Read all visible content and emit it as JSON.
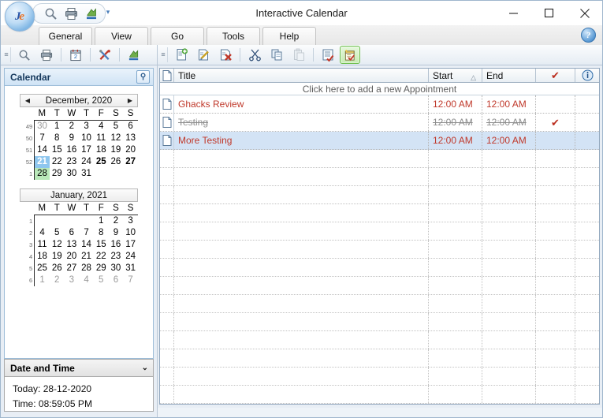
{
  "window": {
    "title": "Interactive Calendar",
    "logo_text_1": "J",
    "logo_text_2": "e",
    "minimize_label": "Minimize",
    "maximize_label": "Maximize",
    "close_label": "Close"
  },
  "quick_access": {
    "items": [
      {
        "name": "search-icon",
        "label": "Search"
      },
      {
        "name": "print-icon",
        "label": "Print"
      },
      {
        "name": "export-icon",
        "label": "Export"
      }
    ],
    "customize_label": "Customize Quick Access Toolbar"
  },
  "tabs": [
    {
      "label": "General"
    },
    {
      "label": "View"
    },
    {
      "label": "Go"
    },
    {
      "label": "Tools"
    },
    {
      "label": "Help"
    }
  ],
  "help_button_label": "?",
  "left_toolbar": {
    "items": [
      {
        "name": "search-icon",
        "label": "Search"
      },
      {
        "name": "print-icon",
        "label": "Print"
      },
      {
        "name": "calendar-icon",
        "label": "Calendar"
      },
      {
        "name": "tools-icon",
        "label": "Tools"
      },
      {
        "name": "export-icon",
        "label": "Export"
      }
    ]
  },
  "right_toolbar": {
    "items": [
      {
        "name": "new-appointment-icon",
        "label": "New Appointment"
      },
      {
        "name": "edit-appointment-icon",
        "label": "Edit Appointment"
      },
      {
        "name": "delete-appointment-icon",
        "label": "Delete Appointment"
      },
      {
        "name": "cut-icon",
        "label": "Cut"
      },
      {
        "name": "copy-icon",
        "label": "Copy"
      },
      {
        "name": "paste-icon",
        "label": "Paste"
      },
      {
        "name": "tasks-icon",
        "label": "Tasks"
      },
      {
        "name": "appointments-icon",
        "label": "Appointments"
      }
    ]
  },
  "calendar_panel": {
    "title": "Calendar",
    "pin_label": "Pin",
    "months": [
      {
        "title": "December, 2020",
        "prev_label": "Previous month",
        "next_label": "Next month",
        "show_nav": true,
        "dow": [
          "M",
          "T",
          "W",
          "T",
          "F",
          "S",
          "S"
        ],
        "weeks": [
          {
            "num": "49",
            "days": [
              {
                "d": "30",
                "cls": "oth"
              },
              {
                "d": "1"
              },
              {
                "d": "2"
              },
              {
                "d": "3"
              },
              {
                "d": "4"
              },
              {
                "d": "5"
              },
              {
                "d": "6"
              }
            ]
          },
          {
            "num": "50",
            "days": [
              {
                "d": "7"
              },
              {
                "d": "8"
              },
              {
                "d": "9"
              },
              {
                "d": "10"
              },
              {
                "d": "11"
              },
              {
                "d": "12"
              },
              {
                "d": "13"
              }
            ]
          },
          {
            "num": "51",
            "days": [
              {
                "d": "14"
              },
              {
                "d": "15"
              },
              {
                "d": "16"
              },
              {
                "d": "17"
              },
              {
                "d": "18"
              },
              {
                "d": "19"
              },
              {
                "d": "20"
              }
            ]
          },
          {
            "num": "52",
            "days": [
              {
                "d": "21",
                "cls": "sel"
              },
              {
                "d": "22"
              },
              {
                "d": "23"
              },
              {
                "d": "24"
              },
              {
                "d": "25",
                "cls": "bold"
              },
              {
                "d": "26"
              },
              {
                "d": "27",
                "cls": "bold"
              }
            ]
          },
          {
            "num": "1",
            "days": [
              {
                "d": "28",
                "cls": "today"
              },
              {
                "d": "29"
              },
              {
                "d": "30"
              },
              {
                "d": "31"
              },
              {
                "d": ""
              },
              {
                "d": ""
              },
              {
                "d": ""
              }
            ]
          }
        ]
      },
      {
        "title": "January, 2021",
        "show_nav": false,
        "dow": [
          "M",
          "T",
          "W",
          "T",
          "F",
          "S",
          "S"
        ],
        "weeks": [
          {
            "num": "1",
            "days": [
              {
                "d": ""
              },
              {
                "d": ""
              },
              {
                "d": ""
              },
              {
                "d": ""
              },
              {
                "d": "1"
              },
              {
                "d": "2"
              },
              {
                "d": "3"
              }
            ]
          },
          {
            "num": "2",
            "days": [
              {
                "d": "4"
              },
              {
                "d": "5"
              },
              {
                "d": "6"
              },
              {
                "d": "7"
              },
              {
                "d": "8"
              },
              {
                "d": "9"
              },
              {
                "d": "10"
              }
            ]
          },
          {
            "num": "3",
            "days": [
              {
                "d": "11"
              },
              {
                "d": "12"
              },
              {
                "d": "13"
              },
              {
                "d": "14"
              },
              {
                "d": "15"
              },
              {
                "d": "16"
              },
              {
                "d": "17"
              }
            ]
          },
          {
            "num": "4",
            "days": [
              {
                "d": "18"
              },
              {
                "d": "19"
              },
              {
                "d": "20"
              },
              {
                "d": "21"
              },
              {
                "d": "22"
              },
              {
                "d": "23"
              },
              {
                "d": "24"
              }
            ]
          },
          {
            "num": "5",
            "days": [
              {
                "d": "25"
              },
              {
                "d": "26"
              },
              {
                "d": "27"
              },
              {
                "d": "28"
              },
              {
                "d": "29"
              },
              {
                "d": "30"
              },
              {
                "d": "31"
              }
            ]
          },
          {
            "num": "6",
            "days": [
              {
                "d": "1",
                "cls": "oth"
              },
              {
                "d": "2",
                "cls": "oth"
              },
              {
                "d": "3",
                "cls": "oth"
              },
              {
                "d": "4",
                "cls": "oth"
              },
              {
                "d": "5",
                "cls": "oth"
              },
              {
                "d": "6",
                "cls": "oth"
              },
              {
                "d": "7",
                "cls": "oth"
              }
            ]
          }
        ]
      }
    ]
  },
  "datetime_panel": {
    "title": "Date and Time",
    "collapse_label": "Collapse",
    "today": "Today: 28-12-2020",
    "time": "Time: 08:59:05 PM"
  },
  "grid": {
    "columns": {
      "icon": "",
      "title": "Title",
      "start": "Start",
      "end": "End",
      "check": "",
      "info": ""
    },
    "sort_indicator": "△",
    "add_row_text": "Click here to add a new Appointment",
    "rows": [
      {
        "title": "Ghacks Review",
        "start": "12:00 AM",
        "end": "12:00 AM",
        "done": false,
        "selected": false
      },
      {
        "title": "Testing",
        "start": "12:00 AM",
        "end": "12:00 AM",
        "done": true,
        "selected": false
      },
      {
        "title": "More Testing",
        "start": "12:00 AM",
        "end": "12:00 AM",
        "done": false,
        "selected": true
      }
    ],
    "empty_row_count": 14
  },
  "colors": {
    "accent_blue": "#2a5a8c",
    "appointment_red": "#c0392b",
    "done_grey": "#8e8e8e",
    "check_red": "#bb2d1e",
    "selection_blue": "#d3e3f5",
    "today_green": "#b9e8b9",
    "selected_day_blue": "#8ec6ee"
  }
}
